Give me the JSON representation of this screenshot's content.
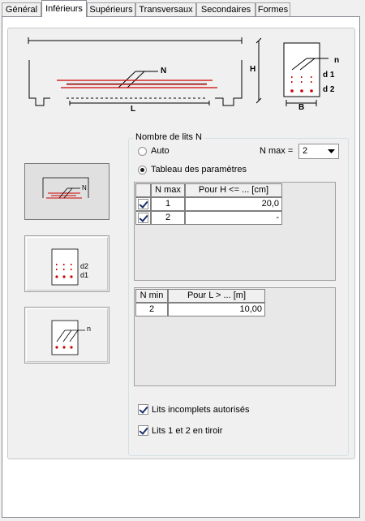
{
  "tabs": [
    {
      "label": "Général",
      "active": false
    },
    {
      "label": "Inférieurs",
      "active": true
    },
    {
      "label": "Supérieurs",
      "active": false
    },
    {
      "label": "Transversaux",
      "active": false
    },
    {
      "label": "Secondaires",
      "active": false
    },
    {
      "label": "Formes",
      "active": false
    }
  ],
  "diagram": {
    "label_n": "N",
    "label_h": "H",
    "label_l": "L",
    "section_n": "n",
    "section_d1": "d 1",
    "section_d2": "d 2",
    "section_b": "B"
  },
  "buttons": {
    "btn1_n": "N",
    "btn2_d2": "d2",
    "btn2_d1": "d1",
    "btn3_n": "n"
  },
  "group": {
    "title": "Nombre de lits N",
    "radio_auto": "Auto",
    "radio_table": "Tableau des paramètres",
    "selected": "table",
    "nmax_label": "N max =",
    "nmax_value": "2"
  },
  "table1": {
    "headers": [
      "N max",
      "Pour H <= ... [cm]"
    ],
    "rows": [
      {
        "checked": true,
        "nmax": "1",
        "value": "20,0"
      },
      {
        "checked": true,
        "nmax": "2",
        "value": "-"
      }
    ]
  },
  "table2": {
    "headers": [
      "N min",
      "Pour L > ... [m]"
    ],
    "rows": [
      {
        "nmin": "2",
        "value": "10,00"
      }
    ]
  },
  "checkboxes": {
    "incomplete": {
      "label": "Lits incomplets autorisés",
      "checked": true
    },
    "drawer": {
      "label": "Lits 1 et 2 en tiroir",
      "checked": true
    }
  },
  "colors": {
    "rebar": "#cc0000",
    "accent": "#1a2f6a"
  }
}
